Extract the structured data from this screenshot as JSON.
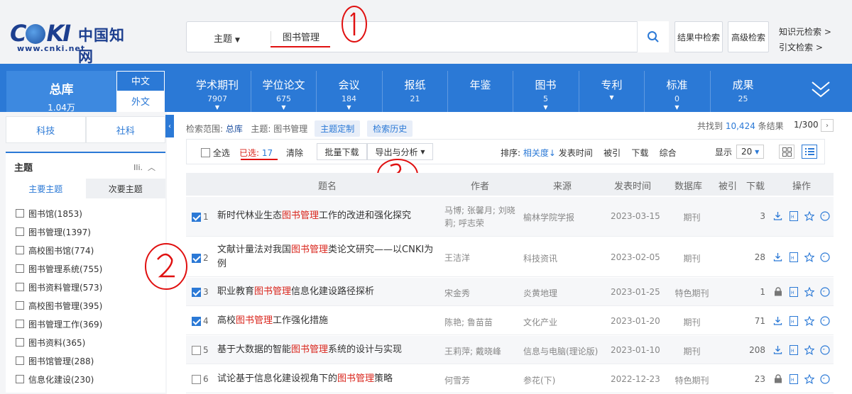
{
  "header": {
    "logo_text": "CNKI",
    "logo_cn": "中国知网",
    "logo_url": "www.cnki.net",
    "search_field": "主题",
    "search_value": "图书管理",
    "search_in_results": "结果中检索",
    "advanced_search": "高级检索",
    "knowledge_search": "知识元检索",
    "citation_search": "引文检索"
  },
  "nav": {
    "total_label": "总库",
    "total_count": "1.04万",
    "lang_cn": "中文",
    "lang_foreign": "外文",
    "categories": [
      {
        "label": "学术期刊",
        "count": "7907"
      },
      {
        "label": "学位论文",
        "count": "675"
      },
      {
        "label": "会议",
        "count": "184"
      },
      {
        "label": "报纸",
        "count": "21"
      },
      {
        "label": "年鉴",
        "count": ""
      },
      {
        "label": "图书",
        "count": "5"
      },
      {
        "label": "专利",
        "count": ""
      },
      {
        "label": "标准",
        "count": "0"
      },
      {
        "label": "成果",
        "count": "25"
      }
    ]
  },
  "sidebar": {
    "tab_tech": "科技",
    "tab_social": "社科",
    "section_title": "主题",
    "sub_main": "主要主题",
    "sub_secondary": "次要主题",
    "items": [
      "图书馆(1853)",
      "图书管理(1397)",
      "高校图书馆(774)",
      "图书管理系统(755)",
      "图书资料管理(573)",
      "高校图书管理(395)",
      "图书管理工作(369)",
      "图书资料(365)",
      "图书馆管理(288)",
      "信息化建设(230)"
    ]
  },
  "results": {
    "scope_label": "检索范围:",
    "scope_value": "总库",
    "topic_label": "主题:",
    "topic_value": "图书管理",
    "custom_topic": "主题定制",
    "history": "检索历史",
    "found_prefix": "共找到",
    "found_count": "10,424",
    "found_suffix": "条结果",
    "page": "1/300"
  },
  "toolbar": {
    "select_all": "全选",
    "selected_label": "已选:",
    "selected_count": "17",
    "clear": "清除",
    "batch_download": "批量下载",
    "export": "导出与分析",
    "sort_label": "排序:",
    "sort_relevance": "相关度",
    "sort_date": "发表时间",
    "sort_cited": "被引",
    "sort_download": "下载",
    "sort_overall": "综合",
    "show_label": "显示",
    "show_value": "20"
  },
  "table": {
    "headers": {
      "title": "题名",
      "author": "作者",
      "source": "来源",
      "date": "发表时间",
      "db": "数据库",
      "cited": "被引",
      "downloads": "下载",
      "ops": "操作"
    },
    "rows": [
      {
        "no": "1",
        "checked": true,
        "pre": "新时代林业生态",
        "hl": "图书管理",
        "post": "工作的改进和强化探究",
        "author": "马博; 张馨月; 刘晓莉; 呼志荣",
        "source": "榆林学院学报",
        "date": "2023-03-15",
        "db": "期刊",
        "cited": "",
        "downloads": "3"
      },
      {
        "no": "2",
        "checked": true,
        "pre": "文献计量法对我国",
        "hl": "图书管理",
        "post": "类论文研究——以CNKI为例",
        "author": "王洁洋",
        "source": "科技资讯",
        "date": "2023-02-05",
        "db": "期刊",
        "cited": "",
        "downloads": "28"
      },
      {
        "no": "3",
        "checked": true,
        "pre": "职业教育",
        "hl": "图书管理",
        "post": "信息化建设路径探析",
        "author": "宋金秀",
        "source": "炎黄地理",
        "date": "2023-01-25",
        "db": "特色期刊",
        "cited": "",
        "downloads": "1"
      },
      {
        "no": "4",
        "checked": true,
        "pre": "高校",
        "hl": "图书管理",
        "post": "工作强化措施",
        "author": "陈艳; 鲁苗苗",
        "source": "文化产业",
        "date": "2023-01-20",
        "db": "期刊",
        "cited": "",
        "downloads": "71"
      },
      {
        "no": "5",
        "checked": false,
        "pre": "基于大数据的智能",
        "hl": "图书管理",
        "post": "系统的设计与实现",
        "author": "王莉萍; 戴晓峰",
        "source": "信息与电脑(理论版)",
        "date": "2023-01-10",
        "db": "期刊",
        "cited": "",
        "downloads": "208"
      },
      {
        "no": "6",
        "checked": false,
        "pre": "试论基于信息化建设视角下的",
        "hl": "图书管理",
        "post": "策略",
        "author": "何雪芳",
        "source": "参花(下)",
        "date": "2022-12-23",
        "db": "特色期刊",
        "cited": "",
        "downloads": "23"
      }
    ]
  },
  "colors": {
    "accent": "#2b79d6",
    "highlight": "#d9251c",
    "annotation": "#e01010"
  },
  "icons": [
    "search-icon",
    "download-icon",
    "html-read-icon",
    "star-icon",
    "quote-icon",
    "lock-icon",
    "chevron-down-icon",
    "chevron-left-icon",
    "chevron-right-icon",
    "bar-sort-icon",
    "grid-view-icon",
    "list-view-icon"
  ]
}
